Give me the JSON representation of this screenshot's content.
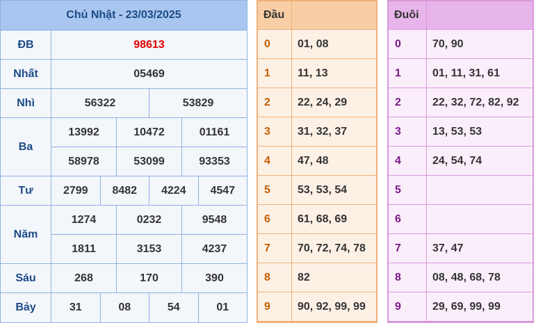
{
  "results": {
    "title": "Chủ Nhật - 23/03/2025",
    "prizes": [
      {
        "label": "ĐB",
        "lines": [
          [
            "98613"
          ]
        ],
        "special": true
      },
      {
        "label": "Nhất",
        "lines": [
          [
            "05469"
          ]
        ]
      },
      {
        "label": "Nhì",
        "lines": [
          [
            "56322",
            "53829"
          ]
        ]
      },
      {
        "label": "Ba",
        "lines": [
          [
            "13992",
            "10472",
            "01161"
          ],
          [
            "58978",
            "53099",
            "93353"
          ]
        ]
      },
      {
        "label": "Tư",
        "lines": [
          [
            "2799",
            "8482",
            "4224",
            "4547"
          ]
        ]
      },
      {
        "label": "Năm",
        "lines": [
          [
            "1274",
            "0232",
            "9548"
          ],
          [
            "1811",
            "3153",
            "4237"
          ]
        ]
      },
      {
        "label": "Sáu",
        "lines": [
          [
            "268",
            "170",
            "390"
          ]
        ]
      },
      {
        "label": "Bảy",
        "lines": [
          [
            "31",
            "08",
            "54",
            "01"
          ]
        ]
      }
    ]
  },
  "head_table": {
    "header": "Đầu",
    "rows": [
      {
        "digit": "0",
        "values": "01, 08"
      },
      {
        "digit": "1",
        "values": "11, 13"
      },
      {
        "digit": "2",
        "values": "22, 24, 29"
      },
      {
        "digit": "3",
        "values": "31, 32, 37"
      },
      {
        "digit": "4",
        "values": "47, 48"
      },
      {
        "digit": "5",
        "values": "53, 53, 54"
      },
      {
        "digit": "6",
        "values": "61, 68, 69"
      },
      {
        "digit": "7",
        "values": "70, 72, 74, 78"
      },
      {
        "digit": "8",
        "values": "82"
      },
      {
        "digit": "9",
        "values": "90, 92, 99, 99"
      }
    ]
  },
  "tail_table": {
    "header": "Đuôi",
    "rows": [
      {
        "digit": "0",
        "values": "70, 90"
      },
      {
        "digit": "1",
        "values": "01, 11, 31, 61"
      },
      {
        "digit": "2",
        "values": "22, 32, 72, 82, 92"
      },
      {
        "digit": "3",
        "values": "13, 53, 53"
      },
      {
        "digit": "4",
        "values": "24, 54, 74"
      },
      {
        "digit": "5",
        "values": ""
      },
      {
        "digit": "6",
        "values": ""
      },
      {
        "digit": "7",
        "values": "37, 47"
      },
      {
        "digit": "8",
        "values": "08, 48, 68, 78"
      },
      {
        "digit": "9",
        "values": "29, 69, 99, 99"
      }
    ]
  }
}
